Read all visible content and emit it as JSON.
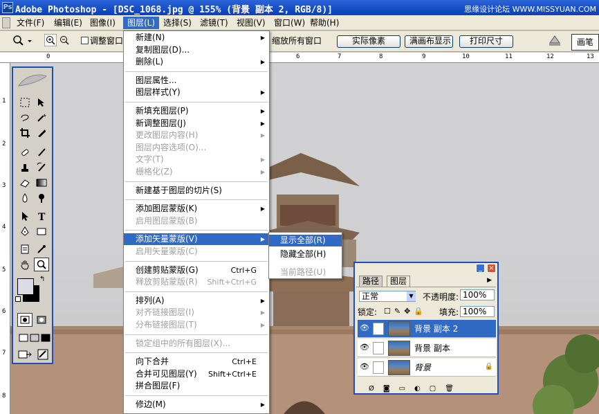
{
  "window": {
    "title": "Adobe Photoshop - [DSC_1068.jpg @ 155% (背景 副本 2, RGB/8)]",
    "watermark": "思缘设计论坛 WWW.MISSYUAN.COM"
  },
  "menubar": {
    "items": [
      "文件(F)",
      "编辑(E)",
      "图像(I)",
      "图层(L)",
      "选择(S)",
      "滤镜(T)",
      "视图(V)",
      "窗口(W)",
      "帮助(H)"
    ],
    "active_index": 3
  },
  "options": {
    "resize_window_label": "调整窗口",
    "zoom_all_label": "缩放所有窗口",
    "actual_pixels": "实际像素",
    "fit_screen": "满画布显示",
    "print_size": "打印尺寸",
    "brush_tab": "画笔"
  },
  "ruler": {
    "top_ticks": [
      "0",
      "6",
      "7",
      "8",
      "9",
      "10",
      "11",
      "12",
      "13"
    ],
    "left_ticks": [
      "1",
      "2",
      "3",
      "4",
      "5",
      "6",
      "7",
      "8"
    ]
  },
  "layer_menu": {
    "items": [
      {
        "label": "新建(N)",
        "arrow": true
      },
      {
        "label": "复制图层(D)..."
      },
      {
        "label": "删除(L)",
        "arrow": true
      },
      {
        "sep": true
      },
      {
        "label": "图层属性..."
      },
      {
        "label": "图层样式(Y)",
        "arrow": true
      },
      {
        "sep": true
      },
      {
        "label": "新填充图层(P)",
        "arrow": true
      },
      {
        "label": "新调整图层(J)",
        "arrow": true
      },
      {
        "label": "更改图层内容(H)",
        "disabled": true,
        "arrow": true
      },
      {
        "label": "图层内容选项(O)...",
        "disabled": true
      },
      {
        "label": "文字(T)",
        "disabled": true,
        "arrow": true
      },
      {
        "label": "栅格化(Z)",
        "disabled": true,
        "arrow": true
      },
      {
        "sep": true
      },
      {
        "label": "新建基于图层的切片(S)"
      },
      {
        "sep": true
      },
      {
        "label": "添加图层蒙版(K)",
        "arrow": true
      },
      {
        "label": "启用图层蒙版(B)",
        "disabled": true
      },
      {
        "sep": true
      },
      {
        "label": "添加矢量蒙版(V)",
        "arrow": true,
        "highlight": true
      },
      {
        "label": "启用矢量蒙版(C)",
        "disabled": true
      },
      {
        "sep": true
      },
      {
        "label": "创建剪贴蒙版(G)",
        "shortcut": "Ctrl+G"
      },
      {
        "label": "释放剪贴蒙版(R)",
        "shortcut": "Shift+Ctrl+G",
        "disabled": true
      },
      {
        "sep": true
      },
      {
        "label": "排列(A)",
        "arrow": true
      },
      {
        "label": "对齐链接图层(I)",
        "disabled": true,
        "arrow": true
      },
      {
        "label": "分布链接图层(T)",
        "disabled": true,
        "arrow": true
      },
      {
        "sep": true
      },
      {
        "label": "锁定组中的所有图层(X)...",
        "disabled": true
      },
      {
        "sep": true
      },
      {
        "label": "向下合并",
        "shortcut": "Ctrl+E"
      },
      {
        "label": "合并可见图层(Y)",
        "shortcut": "Shift+Ctrl+E"
      },
      {
        "label": "拼合图层(F)"
      },
      {
        "sep": true
      },
      {
        "label": "修边(M)",
        "arrow": true
      }
    ]
  },
  "submenu": {
    "items": [
      {
        "label": "显示全部(R)",
        "highlight": true
      },
      {
        "label": "隐藏全部(H)"
      },
      {
        "label": "当前路径(U)",
        "disabled": true
      }
    ]
  },
  "layers_panel": {
    "tabs": [
      "路径",
      "图层"
    ],
    "active_tab": 1,
    "blend_mode": "正常",
    "opacity_label": "不透明度:",
    "opacity_value": "100%",
    "lock_label": "锁定:",
    "fill_label": "填充:",
    "fill_value": "100%",
    "layers": [
      {
        "name": "背景 副本 2",
        "selected": true
      },
      {
        "name": "背景 副本",
        "selected": false
      },
      {
        "name": "背景",
        "selected": false,
        "locked": true,
        "italic": true
      }
    ]
  }
}
